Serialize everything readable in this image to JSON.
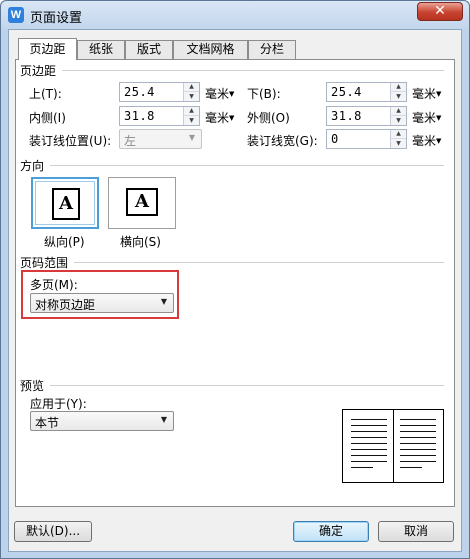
{
  "window": {
    "title": "页面设置",
    "app_icon_letter": "W",
    "close_glyph": "✕"
  },
  "tabs": [
    {
      "label": "页边距",
      "active": true
    },
    {
      "label": "纸张",
      "active": false
    },
    {
      "label": "版式",
      "active": false
    },
    {
      "label": "文档网格",
      "active": false
    },
    {
      "label": "分栏",
      "active": false
    }
  ],
  "margins": {
    "heading": "页边距",
    "top_label": "上(T):",
    "top_value": "25.4",
    "bottom_label": "下(B):",
    "bottom_value": "25.4",
    "inner_label": "内侧(I)",
    "inner_value": "31.8",
    "outer_label": "外侧(O)",
    "outer_value": "31.8",
    "gutter_pos_label": "装订线位置(U):",
    "gutter_pos_value": "左",
    "gutter_width_label": "装订线宽(G):",
    "gutter_width_value": "0",
    "unit": "毫米"
  },
  "orientation": {
    "heading": "方向",
    "glyph": "A",
    "portrait_label": "纵向(P)",
    "landscape_label": "横向(S)",
    "selected": "portrait"
  },
  "pages": {
    "heading": "页码范围",
    "multiple_label": "多页(M):",
    "multiple_value": "对称页边距"
  },
  "preview": {
    "heading": "预览",
    "apply_label": "应用于(Y):",
    "apply_value": "本节"
  },
  "buttons": {
    "default_label": "默认(D)...",
    "ok_label": "确定",
    "cancel_label": "取消"
  },
  "colors": {
    "highlight_border": "#d8393b",
    "selected_border": "#4c9ed9",
    "title_bar": "#c3d6ec"
  }
}
